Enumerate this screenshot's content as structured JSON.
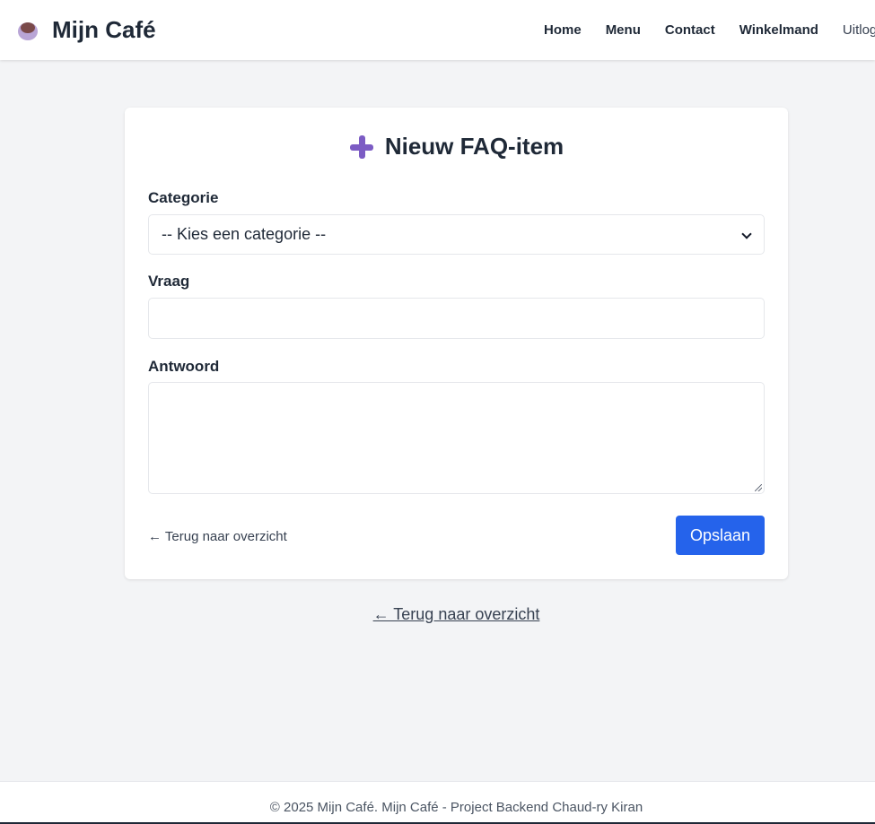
{
  "brand": {
    "name": "Mijn Café",
    "icon": "coffee-cup-icon"
  },
  "nav": {
    "items": [
      {
        "label": "Home"
      },
      {
        "label": "Menu"
      },
      {
        "label": "Contact"
      },
      {
        "label": "Winkelmand"
      }
    ],
    "logout_label": "Uitlog"
  },
  "form": {
    "title": "Nieuw FAQ-item",
    "title_icon": "plus-icon",
    "category_label": "Categorie",
    "category_selected": "-- Kies een categorie --",
    "question_label": "Vraag",
    "question_value": "",
    "answer_label": "Antwoord",
    "answer_value": "",
    "back_label": "← Terug naar overzicht",
    "save_label": "Opslaan"
  },
  "back_link": "← Terug naar overzicht",
  "footer": {
    "text": "© 2025 Mijn Café. Mijn Café - Project Backend Chaud-ry Kiran"
  },
  "colors": {
    "accent": "#2563eb",
    "title_icon": "#7c5cc4",
    "background": "#f3f4f6"
  }
}
